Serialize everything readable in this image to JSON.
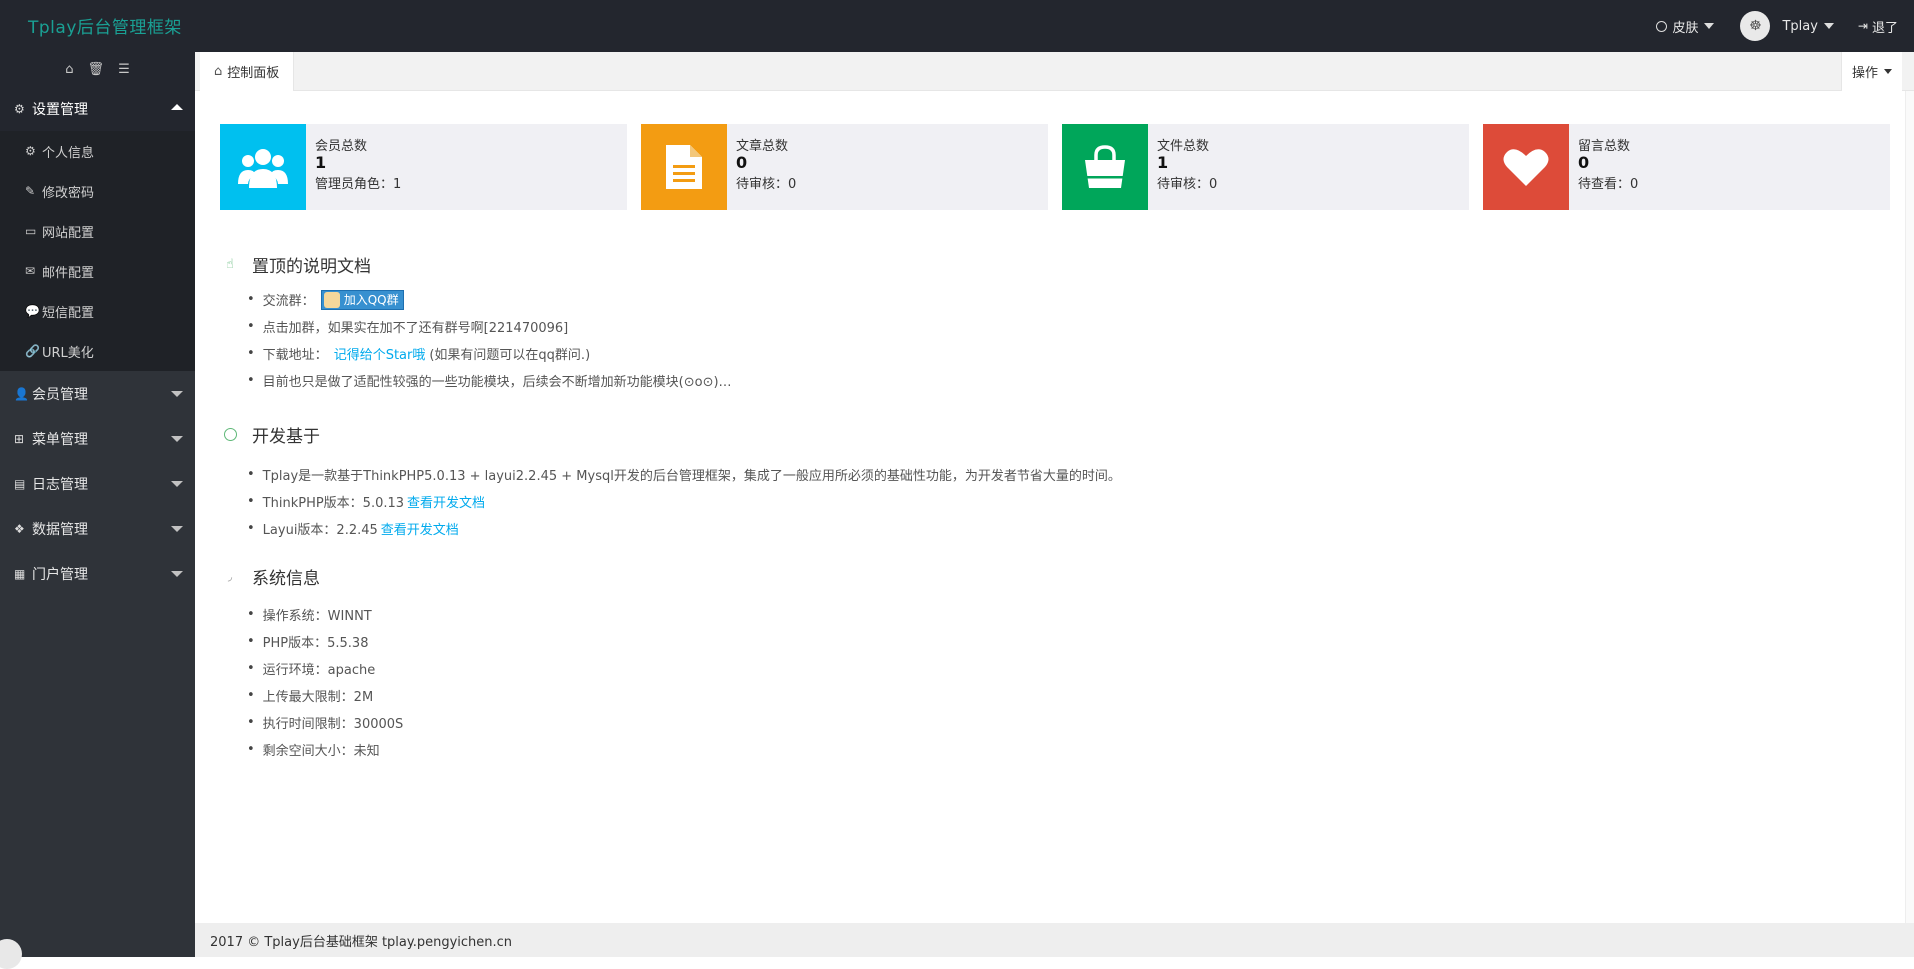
{
  "header": {
    "logo": "Tplay后台管理框架",
    "skin_label": "皮肤",
    "user_name": "Tplay",
    "logout_label": "退了"
  },
  "sidebar": {
    "tools": [
      "home-icon",
      "trash-icon",
      "menu-icon"
    ],
    "groups": [
      {
        "label": "设置管理",
        "icon": "gears-icon",
        "expanded": true,
        "items": [
          {
            "label": "个人信息",
            "icon": "gear-icon"
          },
          {
            "label": "修改密码",
            "icon": "edit-icon"
          },
          {
            "label": "网站配置",
            "icon": "desktop-icon"
          },
          {
            "label": "邮件配置",
            "icon": "envelope-icon"
          },
          {
            "label": "短信配置",
            "icon": "comment-icon"
          },
          {
            "label": "URL美化",
            "icon": "link-icon"
          }
        ]
      },
      {
        "label": "会员管理",
        "icon": "user-icon",
        "expanded": false
      },
      {
        "label": "菜单管理",
        "icon": "sitemap-icon",
        "expanded": false
      },
      {
        "label": "日志管理",
        "icon": "book-icon",
        "expanded": false
      },
      {
        "label": "数据管理",
        "icon": "cubes-icon",
        "expanded": false
      },
      {
        "label": "门户管理",
        "icon": "grid-icon",
        "expanded": false
      }
    ]
  },
  "tabs": {
    "active": "控制面板",
    "ops_label": "操作"
  },
  "stats": [
    {
      "title": "会员总数",
      "count": "1",
      "sub": "管理员角色：1",
      "color": "#00c0ef",
      "icon": "users-icon"
    },
    {
      "title": "文章总数",
      "count": "0",
      "sub": "待审核：0",
      "color": "#f39c12",
      "icon": "document-icon"
    },
    {
      "title": "文件总数",
      "count": "1",
      "sub": "待审核：0",
      "color": "#00a65a",
      "icon": "shopping-bag-icon"
    },
    {
      "title": "留言总数",
      "count": "0",
      "sub": "待查看：0",
      "color": "#dd4b39",
      "icon": "heart-icon"
    }
  ],
  "sections": {
    "docs": {
      "title": "置顶的说明文档",
      "group_label": "交流群：",
      "qq_button": "加入QQ群",
      "line2": "点击加群，如果实在加不了还有群号啊[221470096]",
      "download_label": "下载地址：",
      "download_link": "记得给个Star哦",
      "download_note": "(如果有问题可以在qq群问.)",
      "line4": "目前也只是做了适配性较强的一些功能模块，后续会不断增加新功能模块(⊙o⊙)…"
    },
    "based": {
      "title": "开发基于",
      "line1": "Tplay是一款基于ThinkPHP5.0.13 + layui2.2.45 + Mysql开发的后台管理框架，集成了一般应用所必须的基础性功能，为开发者节省大量的时间。",
      "thinkphp_label": "ThinkPHP版本：5.0.13",
      "thinkphp_link": "查看开发文档",
      "layui_label": "Layui版本：2.2.45",
      "layui_link": "查看开发文档"
    },
    "system": {
      "title": "系统信息",
      "items": [
        "操作系统：WINNT",
        "PHP版本：5.5.38",
        "运行环境：apache",
        "上传最大限制：2M",
        "执行时间限制：30000S",
        "剩余空间大小：未知"
      ]
    }
  },
  "footer": "2017 © Tplay后台基础框架 tplay.pengyichen.cn"
}
